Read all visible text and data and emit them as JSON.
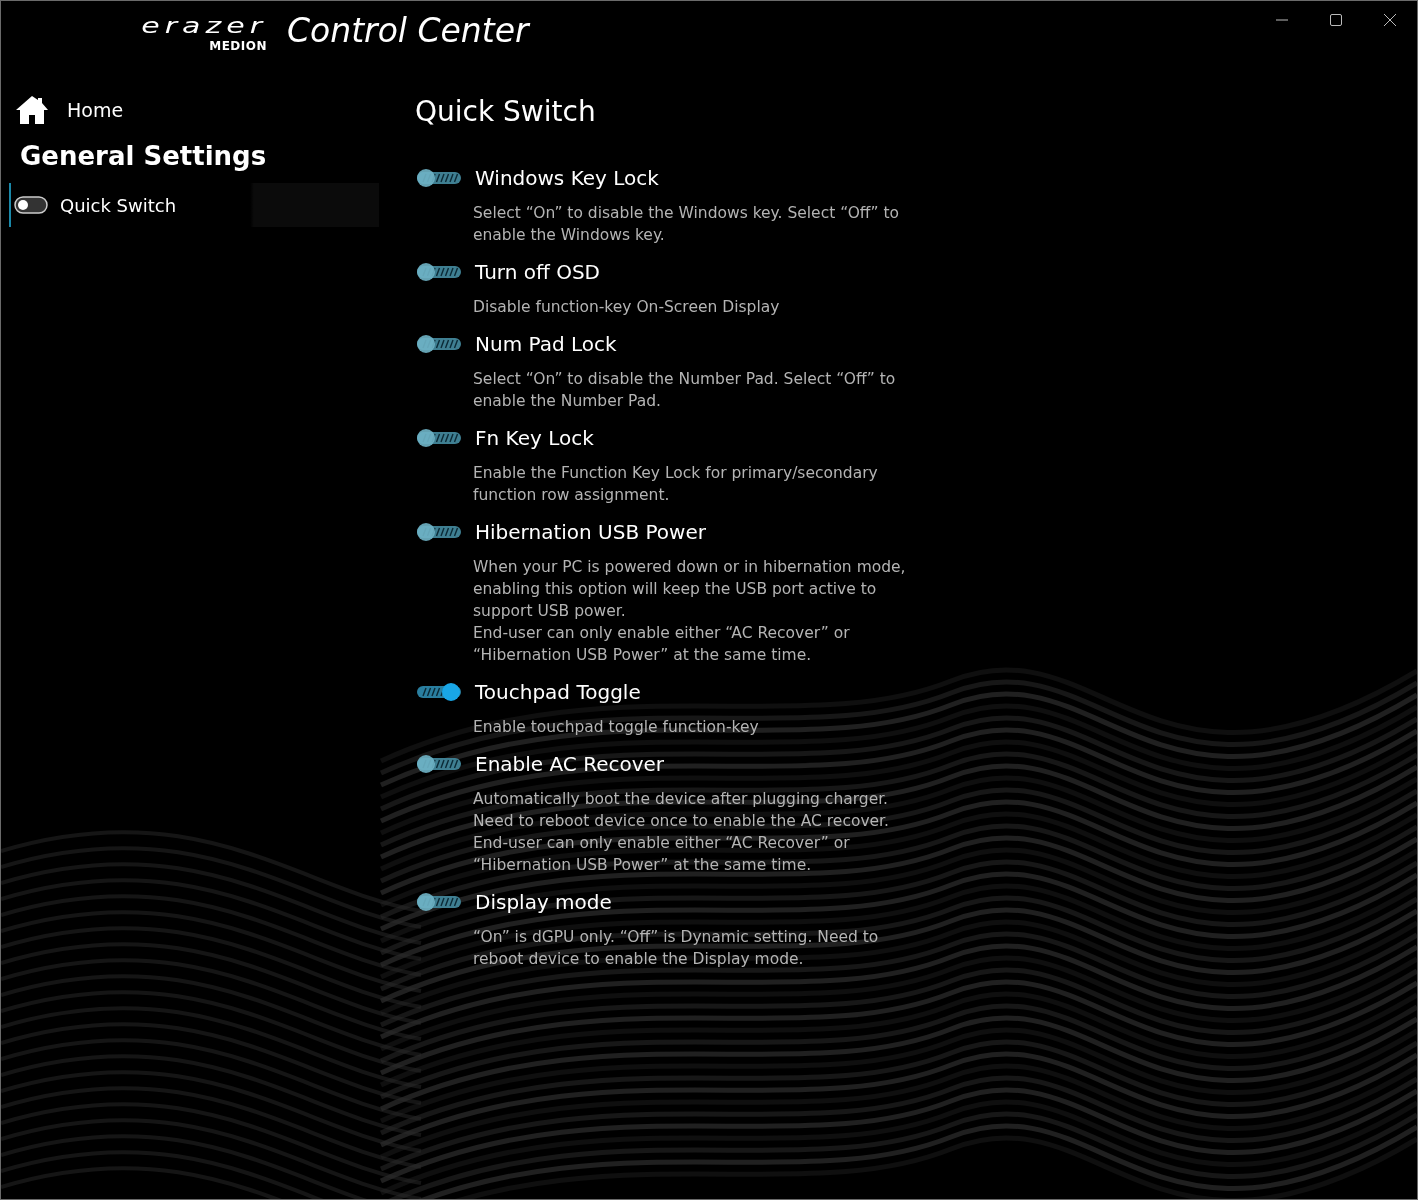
{
  "window": {
    "logo_wordmark": "erazer",
    "logo_brand": "MEDION",
    "title": "Control Center",
    "controls": [
      {
        "kind": "minimize"
      },
      {
        "kind": "maximize"
      },
      {
        "kind": "close"
      }
    ]
  },
  "sidebar": {
    "home": "Home",
    "section": "General Settings",
    "items": [
      {
        "label": "Quick Switch",
        "selected": true
      }
    ]
  },
  "page": {
    "title": "Quick Switch",
    "switches": [
      {
        "label": "Windows Key Lock",
        "on": false,
        "description": [
          "Select “On” to disable the Windows key. Select “Off” to enable the Windows key."
        ]
      },
      {
        "label": "Turn off OSD",
        "on": false,
        "description": [
          "Disable function-key On-Screen Display"
        ]
      },
      {
        "label": "Num Pad Lock",
        "on": false,
        "description": [
          "Select “On” to disable the Number Pad. Select “Off” to enable the Number Pad."
        ]
      },
      {
        "label": "Fn Key Lock",
        "on": false,
        "description": [
          "Enable the Function Key Lock for primary/secondary function row assignment."
        ]
      },
      {
        "label": "Hibernation USB Power",
        "on": false,
        "description": [
          "When your PC is powered down or in hibernation mode, enabling this option will keep the USB port active to support USB power.",
          "End-user can only enable either “AC Recover” or “Hibernation USB Power” at the same time."
        ]
      },
      {
        "label": "Touchpad Toggle",
        "on": true,
        "description": [
          "Enable touchpad toggle function-key"
        ]
      },
      {
        "label": "Enable AC Recover",
        "on": false,
        "description": [
          "Automatically boot the device after plugging charger.",
          "Need to reboot device once to enable the AC recover.",
          "End-user can only enable either “AC Recover” or “Hibernation USB Power” at the same time."
        ]
      },
      {
        "label": "Display mode",
        "on": false,
        "description": [
          "“On” is dGPU only. “Off” is Dynamic setting. Need to reboot device to enable the Display mode."
        ]
      }
    ]
  }
}
